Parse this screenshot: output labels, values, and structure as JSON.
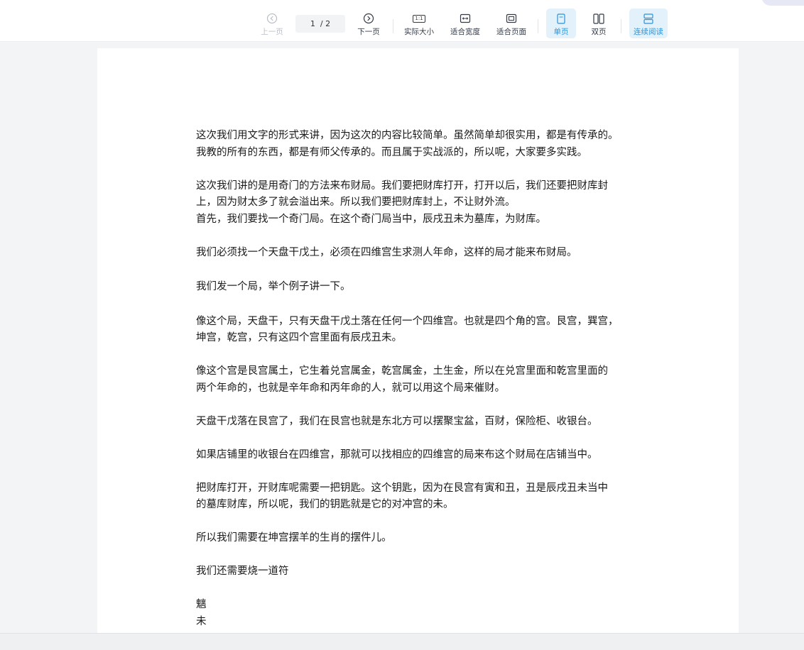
{
  "toolbar": {
    "prev_label": "上一页",
    "next_label": "下一页",
    "page_indicator": "1  / 2",
    "actual_size_label": "实际大小",
    "fit_width_label": "适合宽度",
    "fit_page_label": "适合页面",
    "single_page_label": "单页",
    "double_page_label": "双页",
    "continuous_label": "连续阅读",
    "actual_size_icon_text": "1:1"
  },
  "colors": {
    "accent": "#2a93d8",
    "active_bg": "#e3f1fb"
  },
  "document": {
    "paragraphs": [
      "这次我们用文字的形式来讲，因为这次的内容比较简单。虽然简单却很实用，都是有传承的。\n我教的所有的东西，都是有师父传承的。而且属于实战派的，所以呢，大家要多实践。",
      "这次我们讲的是用奇门的方法来布财局。我们要把财库打开，打开以后，我们还要把财库封\n上，因为财太多了就会溢出来。所以我们要把财库封上，不让财外流。",
      "首先，我们要找一个奇门局。在这个奇门局当中，辰戌丑未为墓库，为财库。",
      "我们必须找一个天盘干戊土，必须在四维宫生求测人年命，这样的局才能来布财局。",
      "我们发一个局，举个例子讲一下。",
      "像这个局，天盘干，只有天盘干戊土落在任何一个四维宫。也就是四个角的宫。艮宫，巽宫，\n坤宫，乾宫，只有这四个宫里面有辰戌丑未。",
      "像这个宫是艮宫属土，它生着兑宫属金，乾宫属金，土生金，所以在兑宫里面和乾宫里面的\n两个年命的，也就是辛年命和丙年命的人，就可以用这个局来催财。",
      "天盘干戊落在艮宫了，我们在艮宫也就是东北方可以摆聚宝盆，百财，保险柜、收银台。",
      "如果店铺里的收银台在四维宫，那就可以找相应的四维宫的局来布这个财局在店铺当中。",
      "把财库打开，开财库呢需要一把钥匙。这个钥匙，因为在艮宫有寅和丑，丑是辰戌丑未当中\n的墓库财库，所以呢，我们的钥匙就是它的对冲宫的未。",
      "所以我们需要在坤宫摆羊的生肖的摆件儿。",
      "我们还需要烧一道符",
      "魑",
      "未"
    ]
  }
}
